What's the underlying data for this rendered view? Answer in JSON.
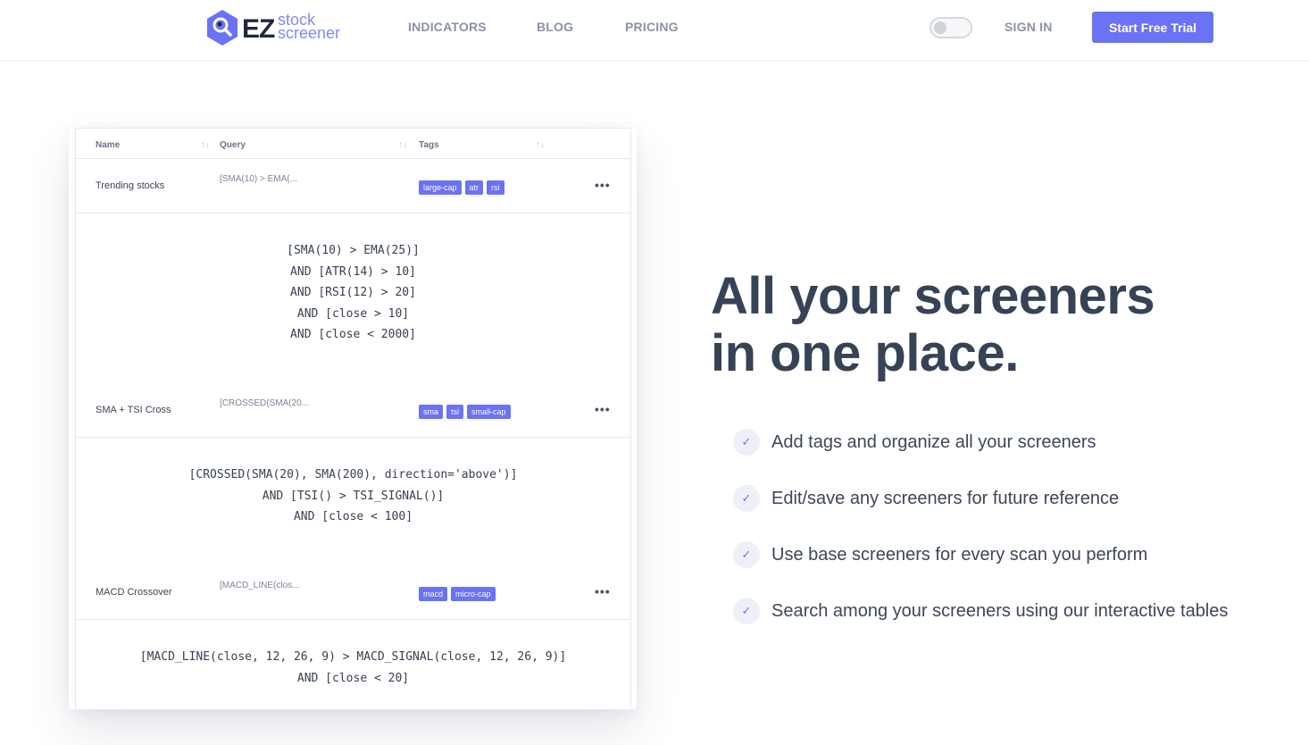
{
  "nav": {
    "logo": {
      "ez": "EZ",
      "line1": "stock",
      "line2": "screener"
    },
    "links": [
      "INDICATORS",
      "BLOG",
      "PRICING"
    ],
    "sign_in": "SIGN IN",
    "cta": "Start Free Trial"
  },
  "table": {
    "headers": [
      "Name",
      "Query",
      "Tags"
    ],
    "sort_glyph": "↑↓",
    "more_glyph": "•••",
    "rows": [
      {
        "name": "Trending stocks",
        "query_short": "[SMA(10) > EMA(...",
        "tags": [
          "large-cap",
          "atr",
          "rsi"
        ],
        "query_lines": [
          "[SMA(10) > EMA(25)]",
          "AND [ATR(14) > 10]",
          "AND [RSI(12) > 20]",
          "AND [close > 10]",
          "AND [close < 2000]"
        ]
      },
      {
        "name": "SMA + TSI Cross",
        "query_short": "[CROSSED(SMA(20...",
        "tags": [
          "sma",
          "tsi",
          "small-cap"
        ],
        "query_lines": [
          "[CROSSED(SMA(20), SMA(200), direction='above')]",
          "AND [TSI() > TSI_SIGNAL()]",
          "AND [close < 100]"
        ]
      },
      {
        "name": "MACD Crossover",
        "query_short": "[MACD_LINE(clos...",
        "tags": [
          "macd",
          "micro-cap"
        ],
        "query_lines": [
          "[MACD_LINE(close, 12, 26, 9) > MACD_SIGNAL(close, 12, 26, 9)]",
          "AND [close < 20]"
        ]
      }
    ]
  },
  "hero": {
    "headline_line1": "All your screeners",
    "headline_line2": "in one place.",
    "check_glyph": "✓",
    "features": [
      "Add tags and organize all your screeners",
      "Edit/save any screeners for future reference",
      "Use base screeners for every scan you perform",
      "Search among your screeners using our interactive tables"
    ]
  },
  "colors": {
    "accent": "#6a72f5",
    "heading": "#364357",
    "muted": "#8a93a6"
  }
}
